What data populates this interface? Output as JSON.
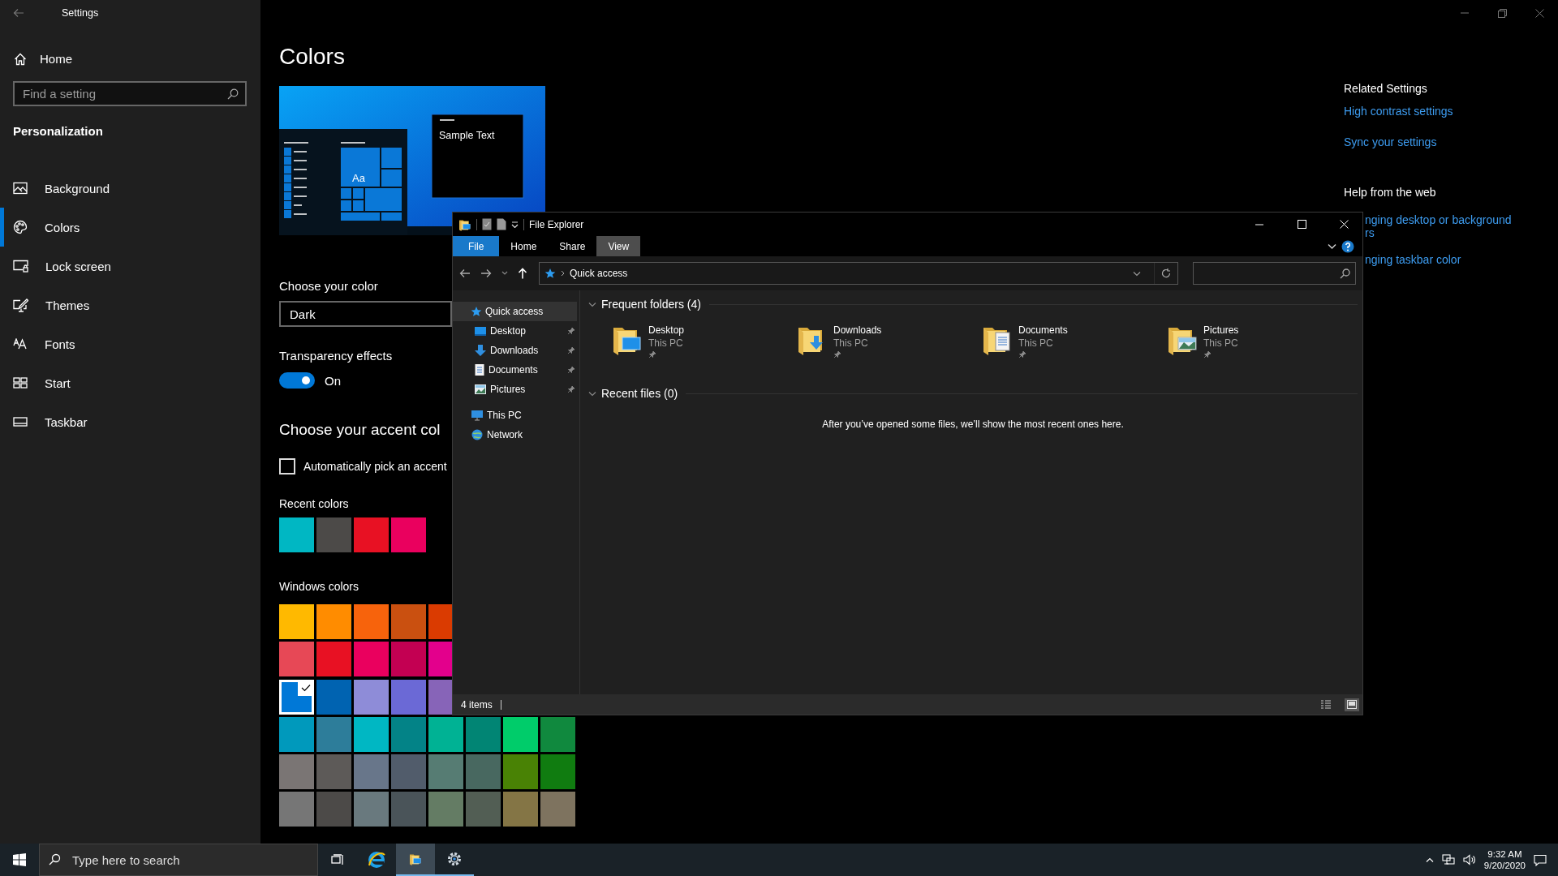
{
  "settings": {
    "title": "Settings",
    "home": "Home",
    "search": {
      "placeholder": "Find a setting"
    },
    "section": "Personalization",
    "nav": [
      {
        "label": "Background",
        "selected": false
      },
      {
        "label": "Colors",
        "selected": true
      },
      {
        "label": "Lock screen",
        "selected": false
      },
      {
        "label": "Themes",
        "selected": false
      },
      {
        "label": "Fonts",
        "selected": false
      },
      {
        "label": "Start",
        "selected": false
      },
      {
        "label": "Taskbar",
        "selected": false
      }
    ],
    "page_title": "Colors",
    "preview": {
      "sample_text": "Sample Text",
      "tile_text": "Aa"
    },
    "color_mode": {
      "label": "Choose your color",
      "value": "Dark"
    },
    "transparency": {
      "label": "Transparency effects",
      "on": true,
      "state_text": "On"
    },
    "accent_heading": "Choose your accent col",
    "auto_pick": {
      "label": "Automatically pick an accent",
      "checked": false
    },
    "recent_colors": {
      "label": "Recent colors",
      "swatches": [
        {
          "color": "#00b7c3"
        },
        {
          "color": "#4c4a48"
        },
        {
          "color": "#e81123"
        },
        {
          "color": "#ea005e"
        }
      ]
    },
    "windows_colors": {
      "label": "Windows colors",
      "rows": [
        [
          {
            "color": "#ffb900",
            "selected": false
          },
          {
            "color": "#ff8c00",
            "selected": false
          },
          {
            "color": "#f7630c",
            "selected": false
          },
          {
            "color": "#ca5010",
            "selected": false
          },
          {
            "color": "#da3b01",
            "selected": false
          }
        ],
        [
          {
            "color": "#e74856",
            "selected": false
          },
          {
            "color": "#e81123",
            "selected": false
          },
          {
            "color": "#ea005e",
            "selected": false
          },
          {
            "color": "#c30052",
            "selected": false
          },
          {
            "color": "#e3008c",
            "selected": false
          }
        ],
        [
          {
            "color": "#0078d7",
            "selected": true
          },
          {
            "color": "#0063b1",
            "selected": false
          },
          {
            "color": "#8e8cd8",
            "selected": false
          },
          {
            "color": "#6b69d6",
            "selected": false
          },
          {
            "color": "#8764b8",
            "selected": false
          }
        ],
        [
          {
            "color": "#0099bc",
            "selected": false
          },
          {
            "color": "#2d7d9a",
            "selected": false
          },
          {
            "color": "#00b7c3",
            "selected": false
          },
          {
            "color": "#038387",
            "selected": false
          },
          {
            "color": "#00b294",
            "selected": false
          },
          {
            "color": "#018574",
            "selected": false
          },
          {
            "color": "#00cc6a",
            "selected": false
          },
          {
            "color": "#10893e",
            "selected": false
          }
        ],
        [
          {
            "color": "#7a7574",
            "selected": false
          },
          {
            "color": "#5d5a58",
            "selected": false
          },
          {
            "color": "#68768a",
            "selected": false
          },
          {
            "color": "#515c6b",
            "selected": false
          },
          {
            "color": "#567c73",
            "selected": false
          },
          {
            "color": "#486860",
            "selected": false
          },
          {
            "color": "#498205",
            "selected": false
          },
          {
            "color": "#107c10",
            "selected": false
          }
        ],
        [
          {
            "color": "#767676",
            "selected": false
          },
          {
            "color": "#4c4a48",
            "selected": false
          },
          {
            "color": "#69797e",
            "selected": false
          },
          {
            "color": "#4a5459",
            "selected": false
          },
          {
            "color": "#647c64",
            "selected": false
          },
          {
            "color": "#525e54",
            "selected": false
          },
          {
            "color": "#847545",
            "selected": false
          },
          {
            "color": "#7e735f",
            "selected": false
          }
        ]
      ]
    },
    "related": {
      "heading": "Related Settings",
      "links": [
        "High contrast settings",
        "Sync your settings"
      ]
    },
    "help": {
      "heading": "Help from the web",
      "links": [
        [
          "nging desktop or background",
          "rs"
        ],
        [
          "nging taskbar color"
        ]
      ]
    }
  },
  "explorer": {
    "title": "File Explorer",
    "ribbon_tabs": [
      {
        "label": "File",
        "kind": "menu",
        "selected": false
      },
      {
        "label": "Home",
        "kind": "tab",
        "selected": false
      },
      {
        "label": "Share",
        "kind": "tab",
        "selected": false
      },
      {
        "label": "View",
        "kind": "tab",
        "selected": true
      }
    ],
    "address": "Quick access",
    "nav": [
      {
        "label": "Quick access",
        "selected": true,
        "children": [
          {
            "label": "Desktop",
            "pinned": true,
            "selected": false
          },
          {
            "label": "Downloads",
            "pinned": true,
            "selected": false
          },
          {
            "label": "Documents",
            "pinned": true,
            "selected": false
          },
          {
            "label": "Pictures",
            "pinned": true,
            "selected": false
          }
        ]
      },
      {
        "label": "This PC",
        "selected": false
      },
      {
        "label": "Network",
        "selected": false
      }
    ],
    "sections": [
      {
        "title": "Frequent folders (4)",
        "expanded": true,
        "folders": [
          {
            "name": "Desktop",
            "location": "This PC",
            "pinned": true
          },
          {
            "name": "Downloads",
            "location": "This PC",
            "pinned": true
          },
          {
            "name": "Documents",
            "location": "This PC",
            "pinned": true
          },
          {
            "name": "Pictures",
            "location": "This PC",
            "pinned": true
          }
        ]
      },
      {
        "title": "Recent files (0)",
        "expanded": true,
        "message": "After you’ve opened some files, we’ll show the most recent ones here."
      }
    ],
    "status": "4 items",
    "views": [
      {
        "selected": false
      },
      {
        "selected": true
      }
    ]
  },
  "taskbar": {
    "search_placeholder": "Type here to search",
    "apps": [
      {
        "running": false,
        "active": false
      },
      {
        "running": false,
        "active": false
      },
      {
        "running": true,
        "active": true
      },
      {
        "running": true,
        "active": false
      }
    ],
    "time": "9:32 AM",
    "date": "9/20/2020"
  }
}
